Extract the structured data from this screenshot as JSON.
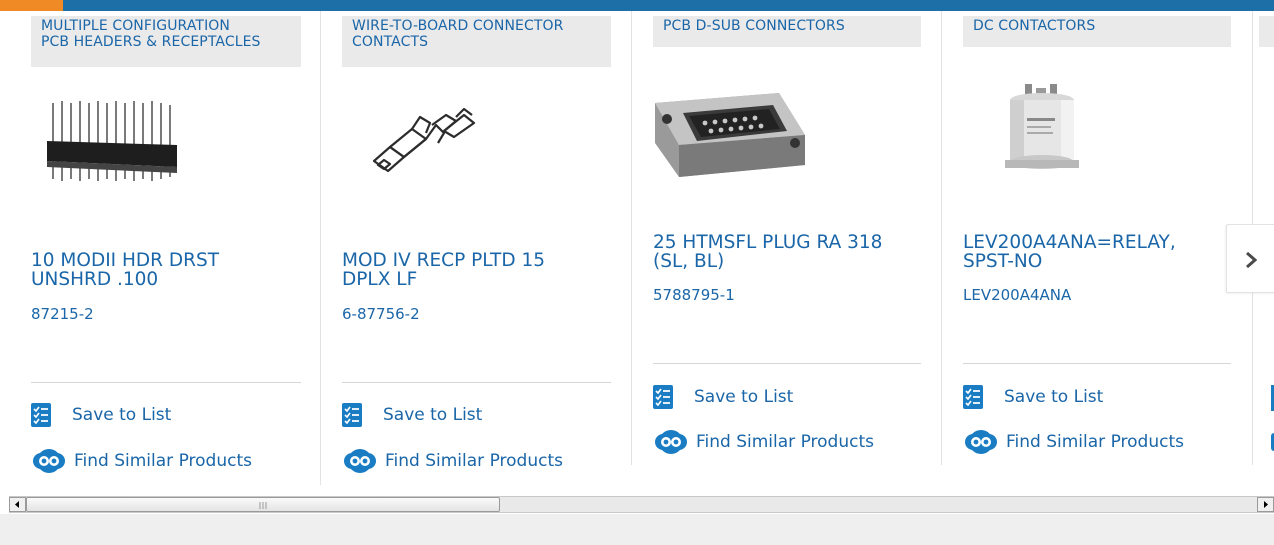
{
  "products": [
    {
      "category": "MULTIPLE CONFIGURATION PCB HEADERS & RECEPTACLES",
      "category_lines": [
        "MULTIPLE CONFIGURATION",
        "PCB HEADERS & RECEPTACLES"
      ],
      "title_lines": [
        "10 MODII HDR DRST",
        "UNSHRD .100"
      ],
      "part_number": "87215-2",
      "save_label": "Save to List",
      "similar_label": "Find Similar Products",
      "image": "pcb-header-image"
    },
    {
      "category": "WIRE-TO-BOARD CONNECTOR CONTACTS",
      "category_lines": [
        "WIRE-TO-BOARD CONNECTOR",
        "CONTACTS"
      ],
      "title_lines": [
        "MOD IV RECP PLTD 15",
        "DPLX LF"
      ],
      "part_number": "6-87756-2",
      "save_label": "Save to List",
      "similar_label": "Find Similar Products",
      "image": "crimp-contact-image"
    },
    {
      "category": "PCB D-SUB CONNECTORS",
      "category_lines": [
        "PCB D-SUB CONNECTORS"
      ],
      "title_lines": [
        "25 HTMSFL PLUG RA 318",
        "(SL, BL)"
      ],
      "part_number": "5788795-1",
      "save_label": "Save to List",
      "similar_label": "Find Similar Products",
      "image": "dsub-connector-image"
    },
    {
      "category": "DC CONTACTORS",
      "category_lines": [
        "DC CONTACTORS"
      ],
      "title_lines": [
        "LEV200A4ANA=RELAY,",
        "SPST-NO"
      ],
      "part_number": "LEV200A4ANA",
      "save_label": "Save to List",
      "similar_label": "Find Similar Products",
      "image": "dc-contactor-image"
    }
  ],
  "icons": {
    "save": "checklist-icon",
    "similar": "find-similar-icon",
    "next": "chevron-right-icon",
    "scroll_left": "arrow-left-icon",
    "scroll_right": "arrow-right-icon"
  },
  "colors": {
    "link": "#1a66a8",
    "top_bar": "#1d6fa8",
    "accent": "#f08a24",
    "tag_bg": "#eaeaea"
  }
}
